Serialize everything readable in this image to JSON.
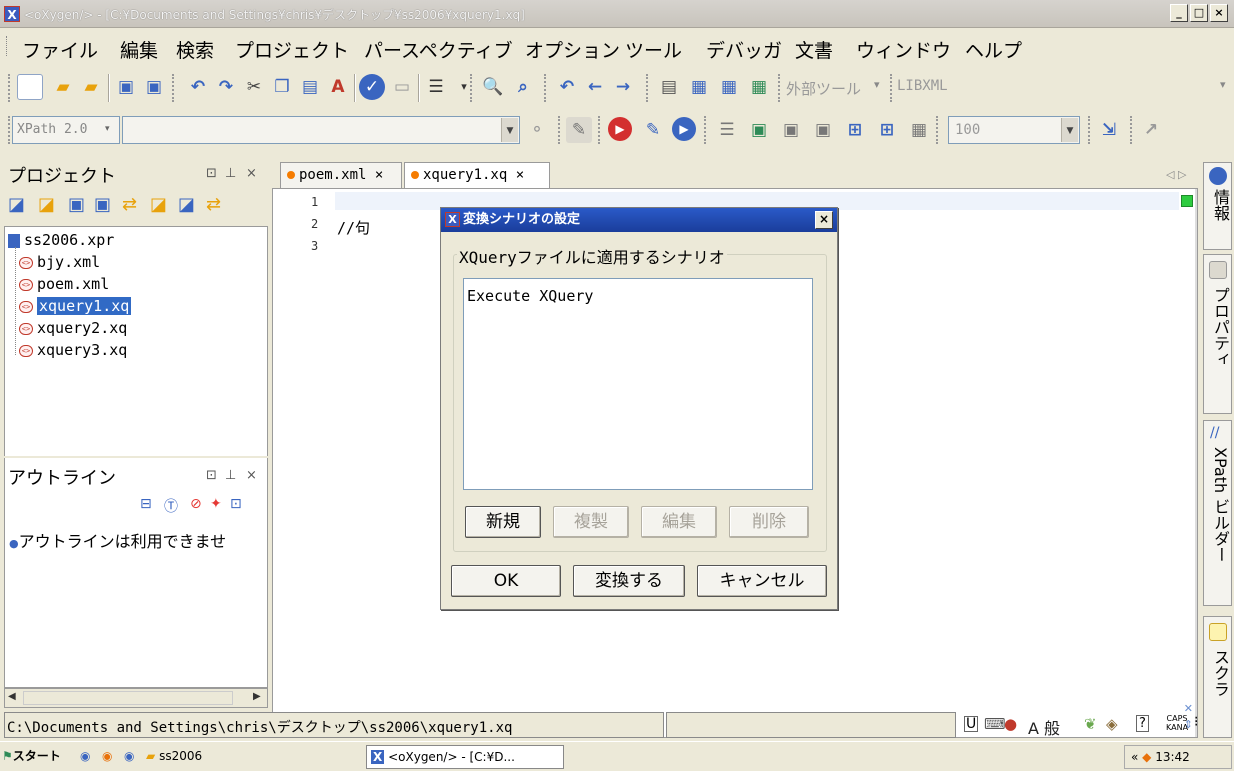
{
  "window": {
    "title": "<oXygen/> - [C:¥Documents and Settings¥chris¥デスクトップ¥ss2006¥xquery1.xq]",
    "buttons": [
      "_",
      "□",
      "×"
    ]
  },
  "menu": [
    "ファイル",
    "編集",
    "検索",
    "プロジェクト",
    "パースペクティブ",
    "オプション",
    "ツール",
    "デバッガ",
    "文書",
    "ウィンドウ",
    "ヘルプ"
  ],
  "toolbar": {
    "external_tools": "外部ツール",
    "libxml": "LIBXML",
    "xpath_version": "XPath 2.0",
    "xpath_input": "",
    "zoom": "100"
  },
  "project_panel": {
    "title": "プロジェクト",
    "root": "ss2006.xpr",
    "files": [
      "bjy.xml",
      "poem.xml",
      "xquery1.xq",
      "xquery2.xq",
      "xquery3.xq"
    ],
    "selected": "xquery1.xq"
  },
  "outline_panel": {
    "title": "アウトライン",
    "message": "アウトラインは利用できませ"
  },
  "editor": {
    "tabs": [
      {
        "label": "poem.xml",
        "active": false
      },
      {
        "label": "xquery1.xq",
        "active": true
      }
    ],
    "lines": [
      "",
      "//句",
      ""
    ],
    "line_numbers": [
      "1",
      "2",
      "3"
    ],
    "nav_arrows": "◁ ▷"
  },
  "dialog": {
    "title": "変換シナリオの設定",
    "group_label": "XQueryファイルに適用するシナリオ",
    "scenarios": [
      "Execute XQuery"
    ],
    "buttons": {
      "new": "新規",
      "duplicate": "複製",
      "edit": "編集",
      "delete": "削除",
      "ok": "OK",
      "transform": "変換する",
      "cancel": "キャンセル"
    },
    "close": "×"
  },
  "side_tabs": {
    "info": "情報",
    "properties": "プロパティ",
    "xpath_builder": "XPath ビルダー",
    "scratch": "スクラ"
  },
  "status": {
    "path": "C:\\Documents and Settings\\chris\\デスクトップ\\ss2006\\xquery1.xq",
    "ime": "A 般",
    "caps": "CAPS",
    "kana": "KANA"
  },
  "taskbar": {
    "start": "スタート",
    "folder": "ss2006",
    "task": "<oXygen/> - [C:¥D...",
    "clock": "13:42"
  },
  "colors": {
    "accent": "#316ac5",
    "title_blue": "#1a3d9b",
    "modified_dot": "#f57c00"
  }
}
